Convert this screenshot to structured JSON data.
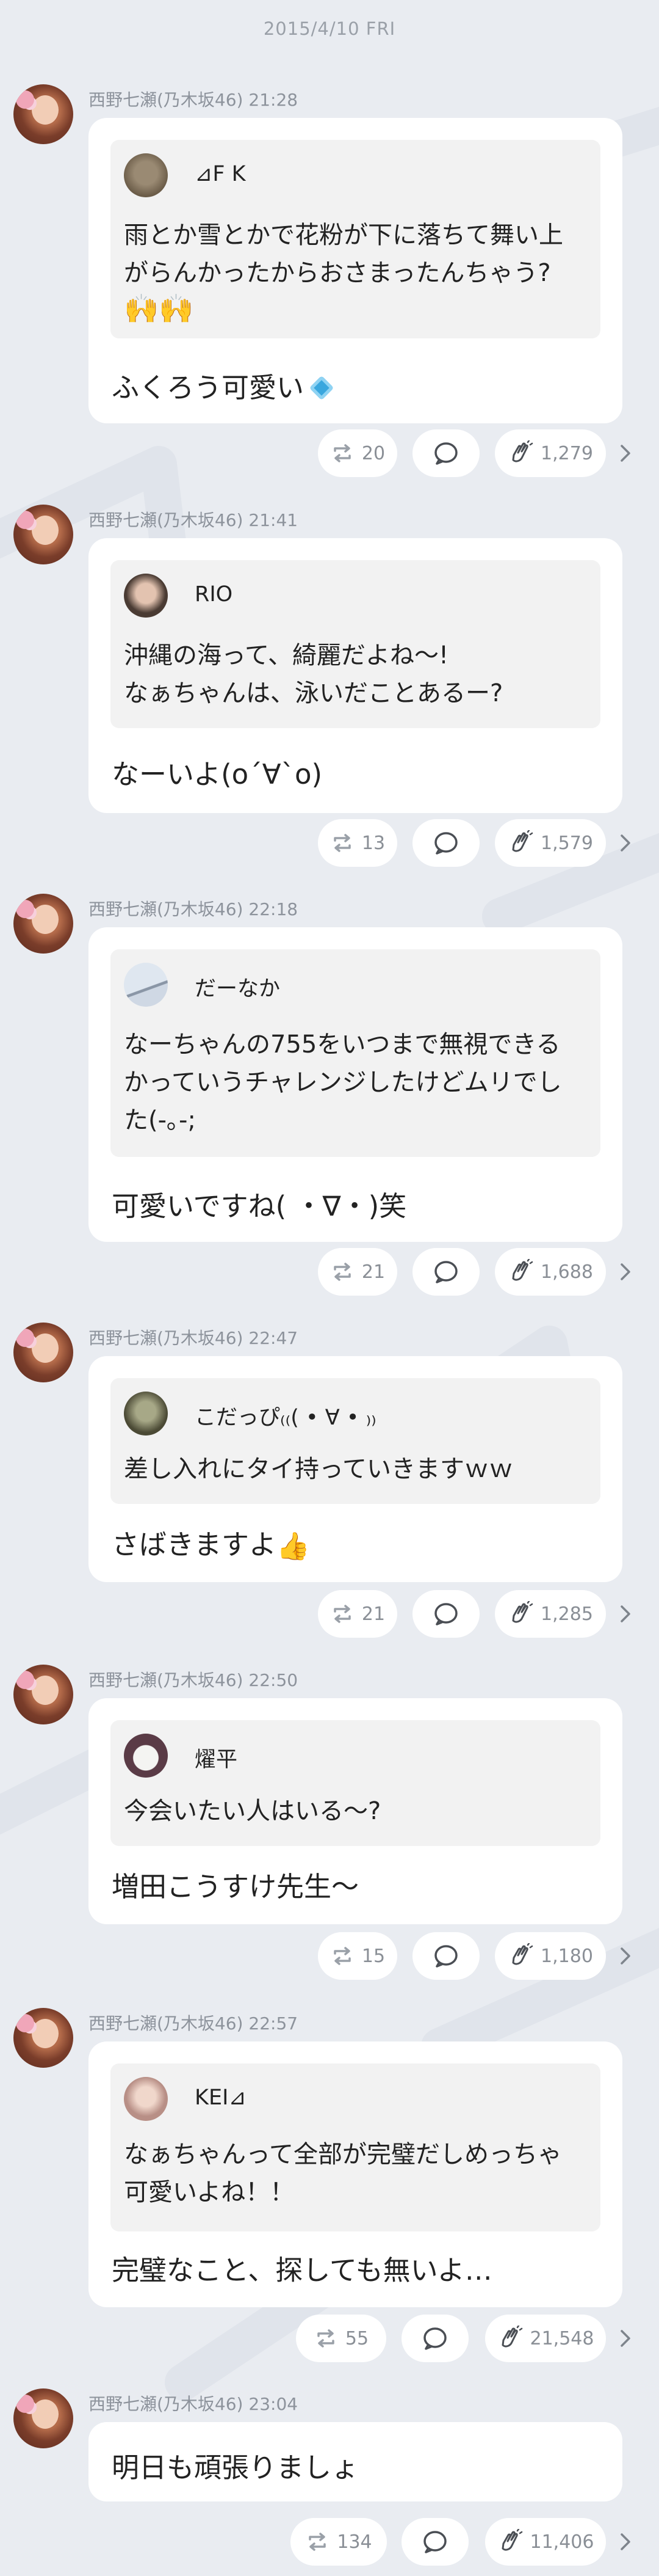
{
  "date_header": "2015/4/10 FRI",
  "posts": [
    {
      "author": "西野七瀬(乃木坂46)",
      "time": "21:28",
      "quote_name": "⊿F K",
      "quote_lines": [
        "雨とか雪とかで花粉が下に落ちて舞い上",
        "がらんかったからおさまったんちゃう?"
      ],
      "quote_emoji": "🙌🙌",
      "reply": "ふくろう可愛い",
      "reply_emoji": "diamond-emoji",
      "retweets": "20",
      "claps": "1,279"
    },
    {
      "author": "西野七瀬(乃木坂46)",
      "time": "21:41",
      "quote_name": "RIO",
      "quote_lines": [
        "沖縄の海って、綺麗だよね〜!",
        "なぁちゃんは、泳いだことあるー?"
      ],
      "reply": "なーいよ(o´∀`o)",
      "retweets": "13",
      "claps": "1,579"
    },
    {
      "author": "西野七瀬(乃木坂46)",
      "time": "22:18",
      "quote_name": "だーなか",
      "quote_lines": [
        "なーちゃんの755をいつまで無視できる",
        "かっていうチャレンジしたけどムリでし",
        "た(-｡-;"
      ],
      "reply": "可愛いですね( ・∇・)笑",
      "retweets": "21",
      "claps": "1,688"
    },
    {
      "author": "西野七瀬(乃木坂46)",
      "time": "22:47",
      "quote_name": "こだっぴ₍₍( • ∀ • ₎₎",
      "quote_lines": [
        "差し入れにタイ持っていきますｗｗ"
      ],
      "reply": "さばきますよ",
      "reply_emoji": "thumbs-up-emoji",
      "retweets": "21",
      "claps": "1,285"
    },
    {
      "author": "西野七瀬(乃木坂46)",
      "time": "22:50",
      "quote_name": "燿平",
      "quote_lines": [
        "今会いたい人はいる〜?"
      ],
      "reply": "増田こうすけ先生～",
      "retweets": "15",
      "claps": "1,180"
    },
    {
      "author": "西野七瀬(乃木坂46)",
      "time": "22:57",
      "quote_name": "KEI⊿",
      "quote_lines": [
        "なぁちゃんって全部が完璧だしめっちゃ",
        "可愛いよね！！"
      ],
      "reply": "完璧なこと、探しても無いよ…",
      "retweets": "55",
      "claps": "21,548"
    },
    {
      "author": "西野七瀬(乃木坂46)",
      "time": "23:04",
      "reply": "明日も頑張りましょ",
      "retweets": "134",
      "claps": "11,406"
    }
  ]
}
